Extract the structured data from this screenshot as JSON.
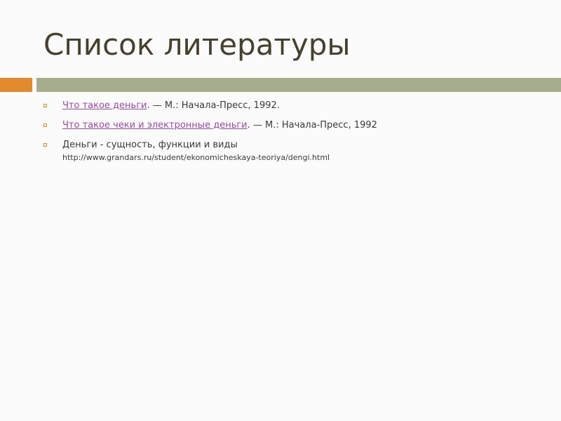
{
  "slide": {
    "title": "Список литературы",
    "items": [
      {
        "link_text": "Что такое деньги",
        "rest": ". — М.: Начала-Пресс, 1992."
      },
      {
        "link_text": "Что такое чеки и электронные деньги",
        "rest": ". — М.: Начала-Пресс, 1992"
      },
      {
        "text": "Деньги - сущность, функции и виды",
        "url": "http://www.grandars.ru/student/ekonomicheskaya-teoriya/dengi.html"
      }
    ]
  },
  "colors": {
    "title": "#46402e",
    "accent_bar": "#e38b2c",
    "main_bar": "#a6ad8d",
    "link": "#9c4aa8",
    "bullet": "#e38b2c"
  }
}
